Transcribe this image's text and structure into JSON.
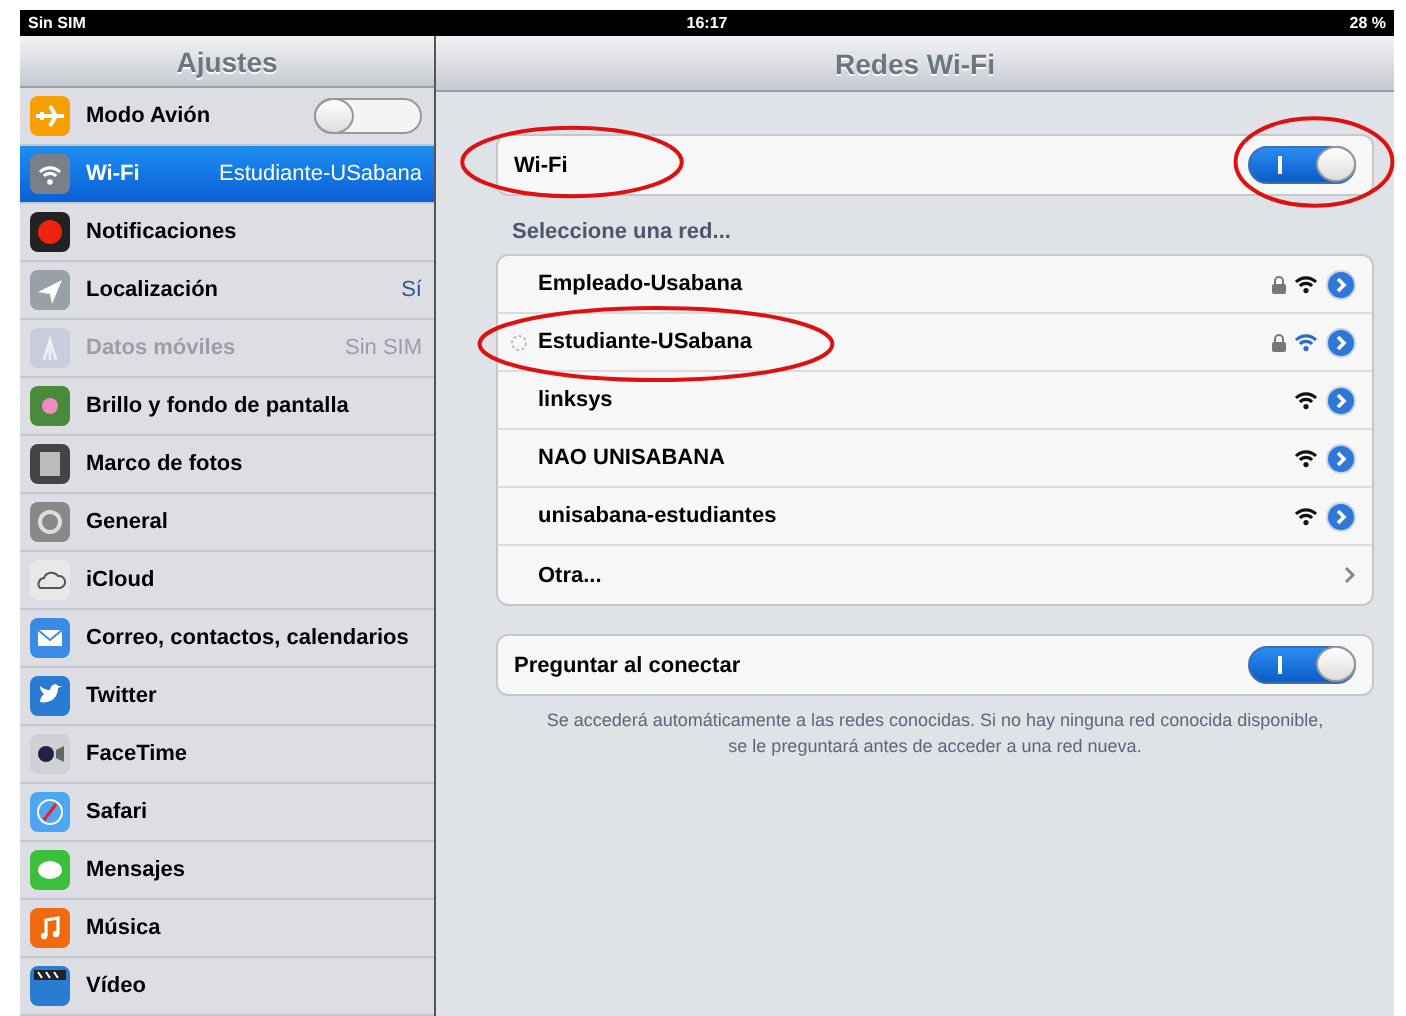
{
  "status_bar": {
    "carrier": "Sin SIM",
    "time": "16:17",
    "battery": "28 %"
  },
  "sidebar": {
    "title": "Ajustes",
    "items": [
      {
        "label": "Modo Avión",
        "kind": "toggle",
        "on": false,
        "selected": false,
        "disabled": false
      },
      {
        "label": "Wi-Fi",
        "value": "Estudiante-USabana",
        "kind": "link",
        "selected": true,
        "disabled": false
      },
      {
        "label": "Notificaciones",
        "kind": "link",
        "selected": false,
        "disabled": false
      },
      {
        "label": "Localización",
        "value": "Sí",
        "kind": "link",
        "selected": false,
        "disabled": false
      },
      {
        "label": "Datos móviles",
        "value": "Sin SIM",
        "kind": "link",
        "selected": false,
        "disabled": true
      },
      {
        "label": "Brillo y fondo de pantalla",
        "kind": "link",
        "selected": false,
        "disabled": false
      },
      {
        "label": "Marco de fotos",
        "kind": "link",
        "selected": false,
        "disabled": false
      },
      {
        "label": "General",
        "kind": "link",
        "selected": false,
        "disabled": false
      },
      {
        "label": "iCloud",
        "kind": "link",
        "selected": false,
        "disabled": false
      },
      {
        "label": "Correo, contactos, calendarios",
        "kind": "link",
        "selected": false,
        "disabled": false
      },
      {
        "label": "Twitter",
        "kind": "link",
        "selected": false,
        "disabled": false
      },
      {
        "label": "FaceTime",
        "kind": "link",
        "selected": false,
        "disabled": false
      },
      {
        "label": "Safari",
        "kind": "link",
        "selected": false,
        "disabled": false
      },
      {
        "label": "Mensajes",
        "kind": "link",
        "selected": false,
        "disabled": false
      },
      {
        "label": "Música",
        "kind": "link",
        "selected": false,
        "disabled": false
      },
      {
        "label": "Vídeo",
        "kind": "link",
        "selected": false,
        "disabled": false
      }
    ]
  },
  "main": {
    "title": "Redes Wi-Fi",
    "wifi": {
      "label": "Wi-Fi",
      "on": true,
      "label_circled": true,
      "toggle_circled": true
    },
    "section_label": "Seleccione una red...",
    "networks": [
      {
        "name": "Empleado-Usabana",
        "locked": true,
        "connected": false,
        "circled": false
      },
      {
        "name": "Estudiante-USabana",
        "locked": true,
        "connected": true,
        "circled": true
      },
      {
        "name": "linksys",
        "locked": false,
        "connected": false,
        "circled": false
      },
      {
        "name": "NAO UNISABANA",
        "locked": false,
        "connected": false,
        "circled": false
      },
      {
        "name": "unisabana-estudiantes",
        "locked": false,
        "connected": false,
        "circled": false
      }
    ],
    "other": "Otra...",
    "ask": {
      "label": "Preguntar al conectar",
      "on": true
    },
    "footnote": "Se accederá automáticamente a las redes conocidas. Si no hay ninguna red conocida disponible, se le preguntará antes de acceder a una red nueva."
  }
}
